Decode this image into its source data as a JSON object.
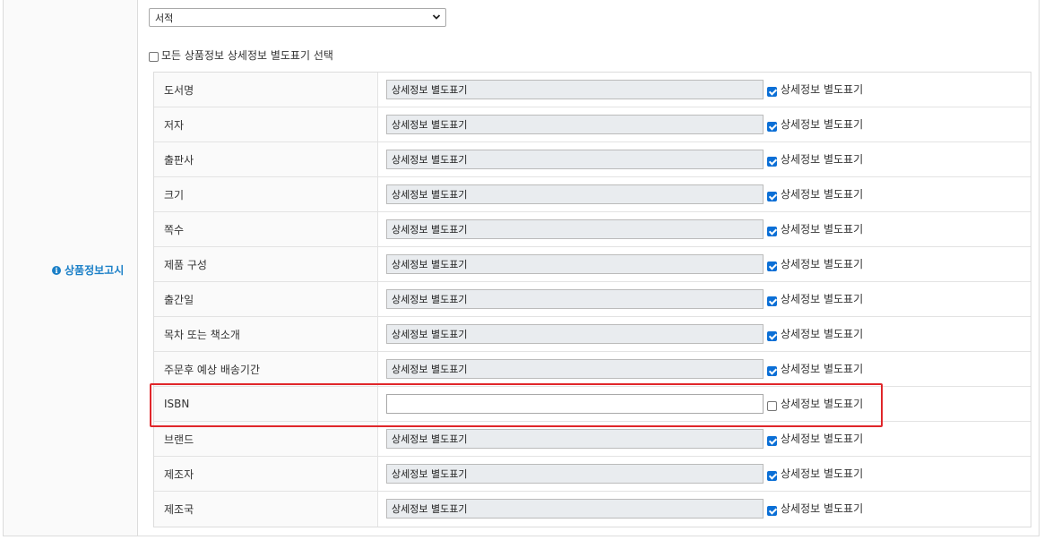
{
  "section": {
    "label": "상품정보고시",
    "icon": "info-icon"
  },
  "category_select": {
    "value": "서적"
  },
  "select_all": {
    "label": "모든 상품정보 상세정보 별도표기 선택",
    "checked": false
  },
  "rows": [
    {
      "label": "도서명",
      "value": "상세정보 별도표기",
      "checkbox_label": "상세정보 별도표기",
      "checked": true,
      "disabled": true
    },
    {
      "label": "저자",
      "value": "상세정보 별도표기",
      "checkbox_label": "상세정보 별도표기",
      "checked": true,
      "disabled": true
    },
    {
      "label": "출판사",
      "value": "상세정보 별도표기",
      "checkbox_label": "상세정보 별도표기",
      "checked": true,
      "disabled": true
    },
    {
      "label": "크기",
      "value": "상세정보 별도표기",
      "checkbox_label": "상세정보 별도표기",
      "checked": true,
      "disabled": true
    },
    {
      "label": "쪽수",
      "value": "상세정보 별도표기",
      "checkbox_label": "상세정보 별도표기",
      "checked": true,
      "disabled": true
    },
    {
      "label": "제품 구성",
      "value": "상세정보 별도표기",
      "checkbox_label": "상세정보 별도표기",
      "checked": true,
      "disabled": true
    },
    {
      "label": "출간일",
      "value": "상세정보 별도표기",
      "checkbox_label": "상세정보 별도표기",
      "checked": true,
      "disabled": true
    },
    {
      "label": "목차 또는 책소개",
      "value": "상세정보 별도표기",
      "checkbox_label": "상세정보 별도표기",
      "checked": true,
      "disabled": true
    },
    {
      "label": "주문후 예상 배송기간",
      "value": "상세정보 별도표기",
      "checkbox_label": "상세정보 별도표기",
      "checked": true,
      "disabled": true
    },
    {
      "label": "ISBN",
      "value": "",
      "checkbox_label": "상세정보 별도표기",
      "checked": false,
      "disabled": false
    },
    {
      "label": "브랜드",
      "value": "상세정보 별도표기",
      "checkbox_label": "상세정보 별도표기",
      "checked": true,
      "disabled": true
    },
    {
      "label": "제조자",
      "value": "상세정보 별도표기",
      "checkbox_label": "상세정보 별도표기",
      "checked": true,
      "disabled": true
    },
    {
      "label": "제조국",
      "value": "상세정보 별도표기",
      "checkbox_label": "상세정보 별도표기",
      "checked": true,
      "disabled": true
    }
  ],
  "colors": {
    "accent": "#1a7fc7",
    "checkbox_checked": "#0b6fd6",
    "highlight": "#e0262a",
    "disabled_input": "#e9ecef"
  }
}
